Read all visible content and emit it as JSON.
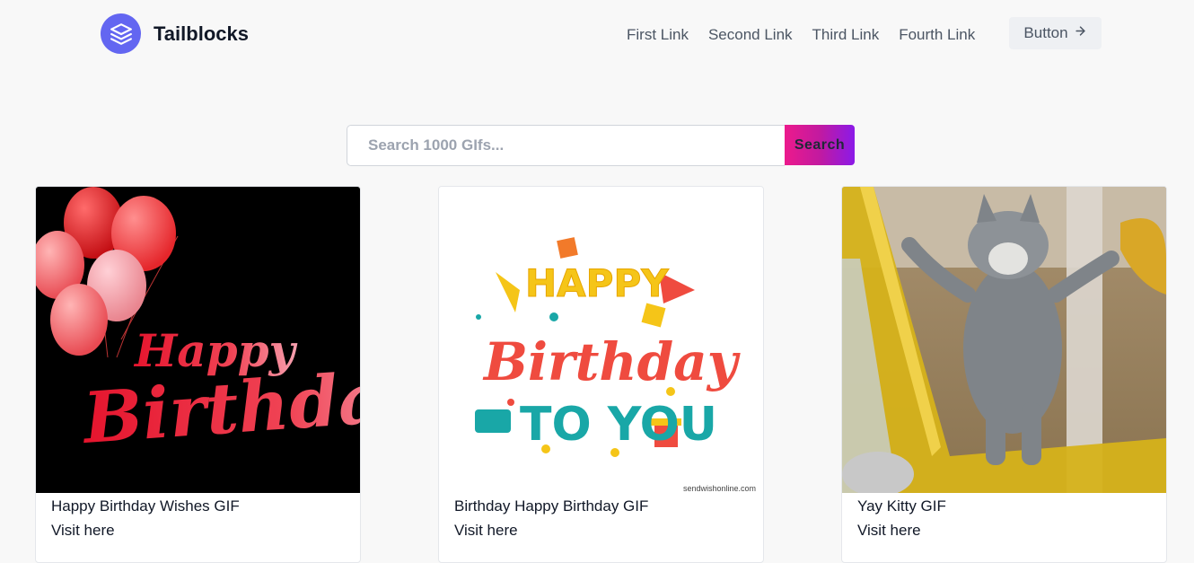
{
  "brand": {
    "name": "Tailblocks",
    "icon": "layers-icon",
    "accent": "#6366f1"
  },
  "nav": {
    "links": [
      "First Link",
      "Second Link",
      "Third Link",
      "Fourth Link"
    ],
    "button_label": "Button",
    "button_icon": "arrow-right-icon"
  },
  "search": {
    "placeholder": "Search 1000 GIfs...",
    "value": "",
    "button_label": "Search",
    "gradient": [
      "#ec1a8c",
      "#8b1ae8"
    ]
  },
  "cards": [
    {
      "title": "Happy Birthday Wishes GIF",
      "link": "Visit here"
    },
    {
      "title": "Birthday Happy Birthday GIF",
      "link": "Visit here",
      "watermark": "sendwishonline.com"
    },
    {
      "title": "Yay Kitty GIF",
      "link": "Visit here"
    }
  ]
}
